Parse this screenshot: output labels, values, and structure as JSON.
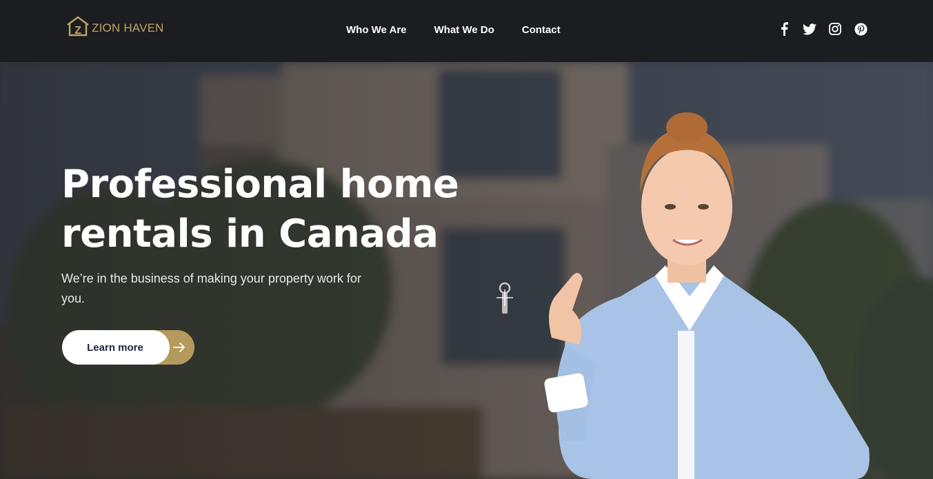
{
  "brand": {
    "name": "ZION HAVEN",
    "logo_letter": "Z",
    "color": "#bfa468"
  },
  "nav": {
    "items": [
      {
        "label": "Who We Are"
      },
      {
        "label": "What We Do"
      },
      {
        "label": "Contact"
      }
    ]
  },
  "social": {
    "icons": [
      "facebook-icon",
      "twitter-icon",
      "instagram-icon",
      "pinterest-icon"
    ]
  },
  "hero": {
    "title_line1": "Professional home",
    "title_line2": "rentals in Canada",
    "subtitle": "We’re in the business of making your property work for you.",
    "cta_label": "Learn more",
    "cta_icon": "arrow-right-icon",
    "accent": "#b59a5d"
  },
  "colors": {
    "header_bg": "#1c1d21",
    "text": "#ffffff"
  }
}
